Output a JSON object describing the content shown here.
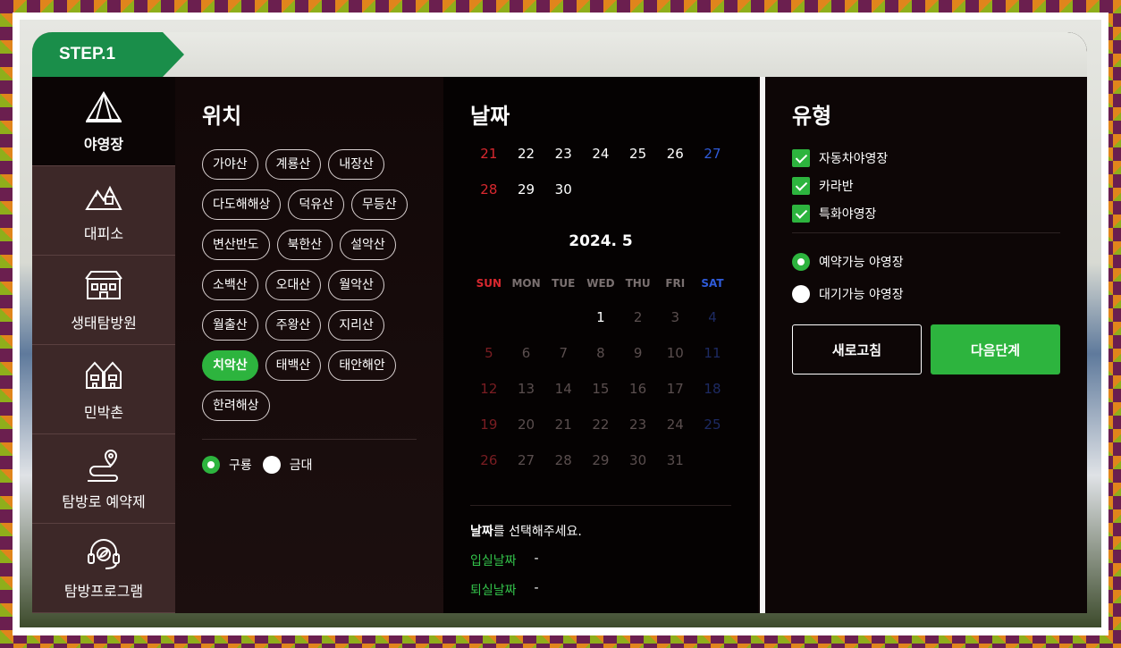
{
  "step": {
    "label": "STEP.1"
  },
  "sidebar": {
    "items": [
      {
        "label": "야영장",
        "icon": "tent-icon"
      },
      {
        "label": "대피소",
        "icon": "mountain-shelter-icon"
      },
      {
        "label": "생태탐방원",
        "icon": "building-icon"
      },
      {
        "label": "민박촌",
        "icon": "houses-icon"
      },
      {
        "label": "탐방로 예약제",
        "icon": "trail-pin-icon"
      },
      {
        "label": "탐방프로그램",
        "icon": "headset-icon"
      }
    ]
  },
  "location": {
    "title": "위치",
    "mountains": [
      "가야산",
      "계룡산",
      "내장산",
      "다도해해상",
      "덕유산",
      "무등산",
      "변산반도",
      "북한산",
      "설악산",
      "소백산",
      "오대산",
      "월악산",
      "월출산",
      "주왕산",
      "지리산",
      "치악산",
      "태백산",
      "태안해안",
      "한려해상"
    ],
    "selected": "치악산",
    "region_options": [
      "구룡",
      "금대"
    ],
    "region_selected": "구룡"
  },
  "date": {
    "title": "날짜",
    "prev_weeks": [
      [
        "21",
        "22",
        "23",
        "24",
        "25",
        "26",
        "27"
      ],
      [
        "28",
        "29",
        "30",
        "",
        "",
        "",
        ""
      ]
    ],
    "month": "2024. 5",
    "dow": [
      "SUN",
      "MON",
      "TUE",
      "WED",
      "THU",
      "FRI",
      "SAT"
    ],
    "weeks": [
      [
        "",
        "",
        "",
        "1",
        "2",
        "3",
        "4"
      ],
      [
        "5",
        "6",
        "7",
        "8",
        "9",
        "10",
        "11"
      ],
      [
        "12",
        "13",
        "14",
        "15",
        "16",
        "17",
        "18"
      ],
      [
        "19",
        "20",
        "21",
        "22",
        "23",
        "24",
        "25"
      ],
      [
        "26",
        "27",
        "28",
        "29",
        "30",
        "31",
        ""
      ]
    ],
    "prompt_strong": "날짜",
    "prompt_rest": "를 선택해주세요.",
    "checkin_label": "입실날짜",
    "checkin_value": "-",
    "checkout_label": "퇴실날짜",
    "checkout_value": "-"
  },
  "type": {
    "title": "유형",
    "checks": [
      "자동차야영장",
      "카라반",
      "특화야영장"
    ],
    "availability": [
      "예약가능 야영장",
      "대기가능 야영장"
    ],
    "availability_selected": "예약가능 야영장",
    "refresh_label": "새로고침",
    "next_label": "다음단계"
  },
  "colors": {
    "accent": "#2db43e",
    "step_tab": "#1a8e4a",
    "sunday": "#d9282f",
    "saturday": "#2f5bd9"
  }
}
